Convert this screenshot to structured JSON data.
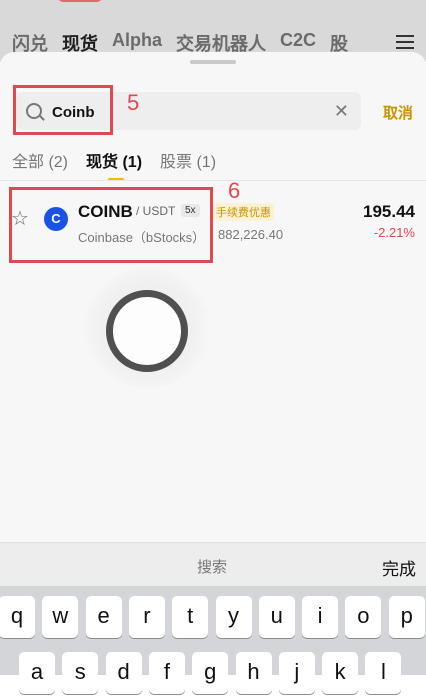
{
  "background": {
    "tabs": [
      "闪兑",
      "现货",
      "Alpha",
      "交易机器人",
      "C2C",
      "股"
    ],
    "active_tab": "现货"
  },
  "search": {
    "value": "Coinb",
    "placeholder": "",
    "cancel_label": "取消"
  },
  "filters": [
    {
      "label": "全部 (2)",
      "active": false
    },
    {
      "label": "现货 (1)",
      "active": true
    },
    {
      "label": "股票 (1)",
      "active": false
    }
  ],
  "result": {
    "symbol": "COINB",
    "quote": "/ USDT",
    "leverage": "5x",
    "fee_tag": "手续费优惠",
    "name": "Coinbase（bStocks）",
    "volume": "882,226.40",
    "price": "195.44",
    "change": "-2.21%",
    "logo_glyph": "C"
  },
  "annotations": {
    "search_step": "5",
    "result_step": "6"
  },
  "keyboard": {
    "title": "搜索",
    "done_label": "完成",
    "row1": [
      "q",
      "w",
      "e",
      "r",
      "t",
      "y",
      "u",
      "i",
      "o",
      "p"
    ],
    "row2": [
      "a",
      "s",
      "d",
      "f",
      "g",
      "h",
      "j",
      "k",
      "l"
    ]
  },
  "colors": {
    "accent": "#f0b90b",
    "cancel": "#c99400",
    "negative": "#e0494f",
    "annotation": "#e0494f",
    "coin_logo": "#1a52e6"
  }
}
